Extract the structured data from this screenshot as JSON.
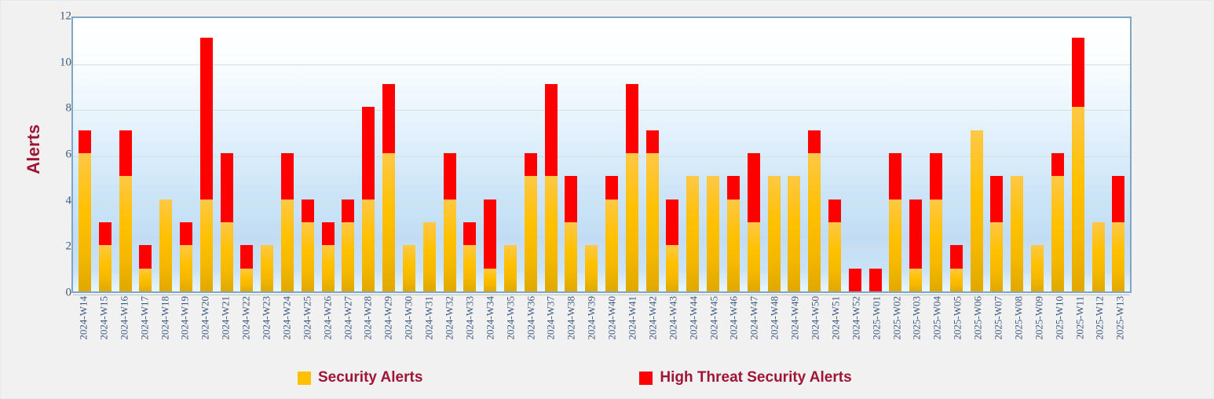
{
  "chart_data": {
    "type": "bar",
    "stacked": true,
    "title": "",
    "subtitle": "",
    "xlabel": "",
    "ylabel": "Alerts",
    "ylim": [
      0,
      12
    ],
    "ytick_step": 2,
    "yticks": [
      12,
      10,
      8,
      6,
      4,
      2,
      0
    ],
    "grid": true,
    "grid_axis": "y",
    "legend_position": "bottom",
    "categories": [
      "2024-W14",
      "2024-W15",
      "2024-W16",
      "2024-W17",
      "2024-W18",
      "2024-W19",
      "2024-W20",
      "2024-W21",
      "2024-W22",
      "2024-W23",
      "2024-W24",
      "2024-W25",
      "2024-W26",
      "2024-W27",
      "2024-W28",
      "2024-W29",
      "2024-W30",
      "2024-W31",
      "2024-W32",
      "2024-W33",
      "2024-W34",
      "2024-W35",
      "2024-W36",
      "2024-W37",
      "2024-W38",
      "2024-W39",
      "2024-W40",
      "2024-W41",
      "2024-W42",
      "2024-W43",
      "2024-W44",
      "2024-W45",
      "2024-W46",
      "2024-W47",
      "2024-W48",
      "2024-W49",
      "2024-W50",
      "2024-W51",
      "2024-W52",
      "2025-W01",
      "2025-W02",
      "2025-W03",
      "2025-W04",
      "2025-W05",
      "2025-W06",
      "2025-W07",
      "2025-W08",
      "2025-W09",
      "2025-W10",
      "2025-W11",
      "2025-W12",
      "2025-W13"
    ],
    "series": [
      {
        "name": "Security Alerts",
        "color": "#FFC000",
        "values": [
          6,
          2,
          5,
          1,
          4,
          2,
          4,
          3,
          1,
          2,
          4,
          3,
          2,
          3,
          4,
          6,
          2,
          3,
          4,
          2,
          1,
          2,
          5,
          5,
          3,
          2,
          4,
          6,
          6,
          2,
          5,
          5,
          4,
          3,
          5,
          5,
          6,
          3,
          0,
          0,
          4,
          1,
          4,
          1,
          7,
          3,
          5,
          2,
          5,
          8,
          3,
          3
        ]
      },
      {
        "name": "High Threat Security Alerts",
        "color": "#FF0000",
        "values": [
          1,
          1,
          2,
          1,
          0,
          1,
          7,
          3,
          1,
          0,
          2,
          1,
          1,
          1,
          4,
          3,
          0,
          0,
          2,
          1,
          3,
          0,
          1,
          4,
          2,
          0,
          1,
          3,
          1,
          2,
          0,
          0,
          1,
          3,
          0,
          0,
          1,
          1,
          1,
          1,
          2,
          3,
          2,
          1,
          0,
          2,
          0,
          0,
          1,
          3,
          0,
          2
        ]
      }
    ],
    "totals": [
      7,
      3,
      7,
      2,
      4,
      3,
      11,
      6,
      2,
      2,
      6,
      4,
      3,
      4,
      8,
      9,
      2,
      3,
      6,
      3,
      4,
      2,
      6,
      9,
      5,
      2,
      5,
      9,
      7,
      4,
      5,
      5,
      5,
      6,
      5,
      5,
      7,
      4,
      1,
      1,
      6,
      4,
      6,
      2,
      7,
      5,
      5,
      2,
      6,
      11,
      3,
      5
    ]
  },
  "legend": {
    "items": [
      {
        "label": "Security Alerts",
        "color": "#FFC000"
      },
      {
        "label": "High Threat Security Alerts",
        "color": "#FF0000"
      }
    ]
  },
  "colors": {
    "series_base": "#FFC000",
    "series_high": "#FF0000",
    "axis_text": "#3D5A80",
    "title_text": "#A01535",
    "plot_border": "#7FA6C4",
    "page_background": "#F1F1F1",
    "gridline": "#D9DDE0"
  }
}
